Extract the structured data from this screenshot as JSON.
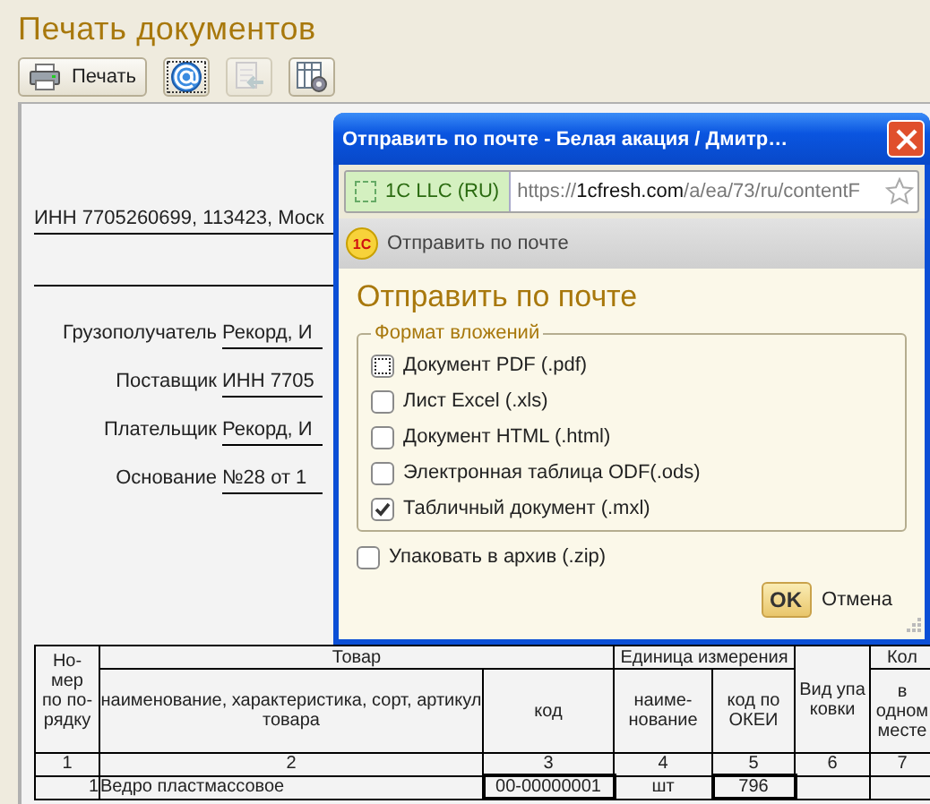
{
  "window": {
    "title": "Печать документов"
  },
  "toolbar": [
    {
      "kind": "print",
      "label": "Печать",
      "focused": false,
      "disabled": false
    },
    {
      "kind": "email",
      "focused": true,
      "disabled": false
    },
    {
      "kind": "import",
      "focused": false,
      "disabled": true
    },
    {
      "kind": "settings",
      "focused": false,
      "disabled": false
    }
  ],
  "document": {
    "address_line": "ИНН 7705260699, 113423, Моск",
    "fields": [
      {
        "label": "Грузополучатель",
        "value": "Рекорд, И"
      },
      {
        "label": "Поставщик",
        "value": "ИНН 7705"
      },
      {
        "label": "Плательщик",
        "value": "Рекорд, И"
      },
      {
        "label": "Основание",
        "value": "№28 от 1"
      }
    ],
    "table": {
      "columns": [
        {
          "label": "Но-мер по по-рядку"
        },
        {
          "label": "Товар",
          "colspan": 2,
          "children": [
            {
              "label": "наименование, характеристика, сорт, артикул товара"
            },
            {
              "label": "код"
            }
          ]
        },
        {
          "label": "Единица измерения",
          "colspan": 2,
          "children": [
            {
              "label": "наиме-нование"
            },
            {
              "label": "код по ОКЕИ"
            }
          ]
        },
        {
          "label": "Вид упаковки"
        },
        {
          "label": "Кол",
          "children": [
            {
              "label": "в одном месте"
            }
          ]
        }
      ],
      "column_numbers": [
        "1",
        "2",
        "3",
        "4",
        "5",
        "6",
        "7"
      ],
      "rows": [
        [
          "1",
          "Ведро пластмассовое",
          "00-00000001",
          "шт",
          "796"
        ]
      ]
    }
  },
  "dialog": {
    "title": "Отправить по почте - Белая акация / Дмитр…",
    "site_identity": "1C LLC (RU)",
    "url_scheme": "https://",
    "url_host": "1cfresh.com",
    "url_path": "/a/ea/73/ru/contentF",
    "logo_text": "1С",
    "tab_title": "Отправить по почте",
    "heading": "Отправить по почте",
    "group_label": "Формат вложений",
    "formats": [
      {
        "label": "Документ PDF (.pdf)",
        "checked": false,
        "focused": true
      },
      {
        "label": "Лист Excel (.xls)",
        "checked": false,
        "focused": false
      },
      {
        "label": "Документ HTML (.html)",
        "checked": false,
        "focused": false
      },
      {
        "label": "Электронная таблица ODF(.ods)",
        "checked": false,
        "focused": false
      },
      {
        "label": "Табличный документ (.mxl)",
        "checked": true,
        "focused": false
      }
    ],
    "archive": {
      "label": "Упаковать в архив (.zip)",
      "checked": false
    },
    "buttons": [
      {
        "kind": "default",
        "label": "OK"
      },
      {
        "kind": "flat",
        "label": "Отмена"
      }
    ]
  }
}
